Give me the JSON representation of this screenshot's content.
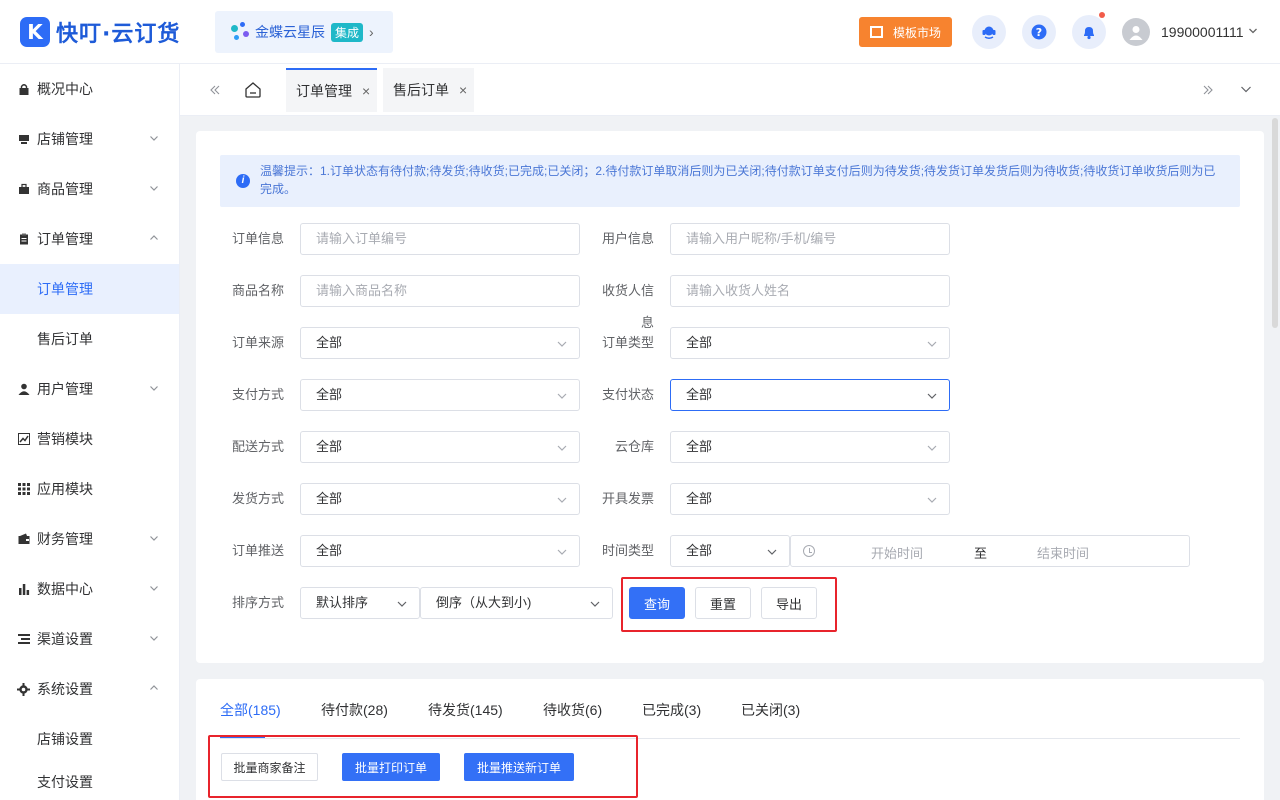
{
  "header": {
    "logo_mark": "K",
    "logo_text": "快叮·云订货",
    "brand_name": "金蝶云星辰",
    "brand_tag": "集成",
    "market_label": "模板市场",
    "user_phone": "19900001111"
  },
  "sidebar": {
    "items": [
      {
        "label": "概况中心",
        "icon": "lock-icon"
      },
      {
        "label": "店铺管理",
        "icon": "store-icon"
      },
      {
        "label": "商品管理",
        "icon": "goods-icon"
      },
      {
        "label": "订单管理",
        "icon": "clipboard-icon"
      },
      {
        "label": "订单管理"
      },
      {
        "label": "售后订单"
      },
      {
        "label": "用户管理",
        "icon": "user-icon"
      },
      {
        "label": "营销模块",
        "icon": "trend-icon"
      },
      {
        "label": "应用模块",
        "icon": "grid-icon"
      },
      {
        "label": "财务管理",
        "icon": "wallet-icon"
      },
      {
        "label": "数据中心",
        "icon": "bar-chart-icon"
      },
      {
        "label": "渠道设置",
        "icon": "list-icon"
      },
      {
        "label": "系统设置",
        "icon": "gear-icon"
      },
      {
        "label": "店铺设置"
      },
      {
        "label": "支付设置"
      }
    ]
  },
  "tabs": [
    {
      "label": "订单管理"
    },
    {
      "label": "售后订单"
    }
  ],
  "notice": "温馨提示：1.订单状态有待付款;待发货;待收货;已完成;已关闭；2.待付款订单取消后则为已关闭;待付款订单支付后则为待发货;待发货订单发货后则为待收货;待收货订单收货后则为已完成。",
  "filters": {
    "order_info": {
      "label": "订单信息",
      "placeholder": "请输入订单编号"
    },
    "user_info": {
      "label": "用户信息",
      "placeholder": "请输入用户昵称/手机/编号"
    },
    "goods_name": {
      "label": "商品名称",
      "placeholder": "请输入商品名称"
    },
    "receiver": {
      "label": "收货人信息",
      "placeholder": "请输入收货人姓名"
    },
    "order_source": {
      "label": "订单来源",
      "value": "全部"
    },
    "order_type": {
      "label": "订单类型",
      "value": "全部"
    },
    "pay_method": {
      "label": "支付方式",
      "value": "全部"
    },
    "pay_status": {
      "label": "支付状态",
      "value": "全部"
    },
    "delivery": {
      "label": "配送方式",
      "value": "全部"
    },
    "warehouse": {
      "label": "云仓库",
      "value": "全部"
    },
    "ship_method": {
      "label": "发货方式",
      "value": "全部"
    },
    "invoice": {
      "label": "开具发票",
      "value": "全部"
    },
    "push": {
      "label": "订单推送",
      "value": "全部"
    },
    "time_type": {
      "label": "时间类型",
      "value": "全部"
    },
    "date_start": "开始时间",
    "date_sep": "至",
    "date_end": "结束时间",
    "sort": {
      "label": "排序方式",
      "value": "默认排序",
      "order": "倒序（从大到小)"
    }
  },
  "actions": {
    "search": "查询",
    "reset": "重置",
    "export": "导出"
  },
  "status_tabs": [
    "全部(185)",
    "待付款(28)",
    "待发货(145)",
    "待收货(6)",
    "已完成(3)",
    "已关闭(3)"
  ],
  "batch": {
    "remark": "批量商家备注",
    "print": "批量打印订单",
    "push": "批量推送新订单"
  },
  "colors": {
    "primary": "#3370f6",
    "market": "#f7832f",
    "highlight_box": "#e8242c",
    "brand_tag": "#1fb8c8"
  }
}
